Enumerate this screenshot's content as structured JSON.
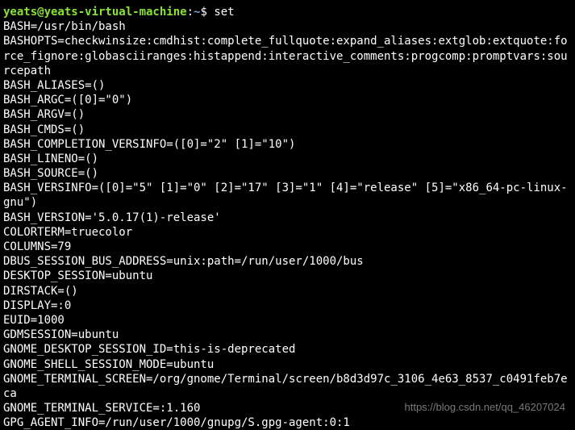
{
  "prompt": {
    "user_host": "yeats@yeats-virtual-machine",
    "separator1": ":",
    "path": "~",
    "separator2": "$ ",
    "command": "set"
  },
  "output_lines": [
    "BASH=/usr/bin/bash",
    "BASHOPTS=checkwinsize:cmdhist:complete_fullquote:expand_aliases:extglob:extquote:force_fignore:globasciiranges:histappend:interactive_comments:progcomp:promptvars:sourcepath",
    "BASH_ALIASES=()",
    "BASH_ARGC=([0]=\"0\")",
    "BASH_ARGV=()",
    "BASH_CMDS=()",
    "BASH_COMPLETION_VERSINFO=([0]=\"2\" [1]=\"10\")",
    "BASH_LINENO=()",
    "BASH_SOURCE=()",
    "BASH_VERSINFO=([0]=\"5\" [1]=\"0\" [2]=\"17\" [3]=\"1\" [4]=\"release\" [5]=\"x86_64-pc-linux-gnu\")",
    "BASH_VERSION='5.0.17(1)-release'",
    "COLORTERM=truecolor",
    "COLUMNS=79",
    "DBUS_SESSION_BUS_ADDRESS=unix:path=/run/user/1000/bus",
    "DESKTOP_SESSION=ubuntu",
    "DIRSTACK=()",
    "DISPLAY=:0",
    "EUID=1000",
    "GDMSESSION=ubuntu",
    "GNOME_DESKTOP_SESSION_ID=this-is-deprecated",
    "GNOME_SHELL_SESSION_MODE=ubuntu",
    "GNOME_TERMINAL_SCREEN=/org/gnome/Terminal/screen/b8d3d97c_3106_4e63_8537_c0491feb7eca",
    "GNOME_TERMINAL_SERVICE=:1.160",
    "GPG_AGENT_INFO=/run/user/1000/gnupg/S.gpg-agent:0:1"
  ],
  "watermark": "https://blog.csdn.net/qq_46207024"
}
